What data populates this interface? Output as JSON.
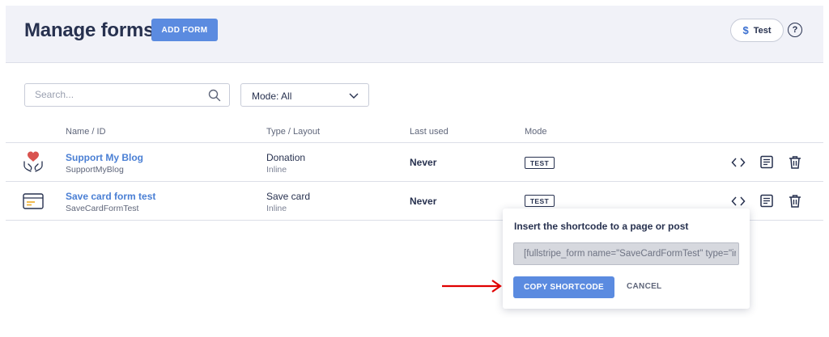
{
  "header": {
    "title": "Manage forms",
    "add_form_label": "ADD FORM",
    "mode_symbol": "$",
    "mode_label": "Test",
    "help_symbol": "?"
  },
  "filters": {
    "search_placeholder": "Search...",
    "mode_select_value": "Mode: All"
  },
  "table": {
    "columns": [
      "Name / ID",
      "Type / Layout",
      "Last used",
      "Mode"
    ],
    "rows": [
      {
        "icon": "heart-hands-icon",
        "name": "Support My Blog",
        "id": "SupportMyBlog",
        "type": "Donation",
        "layout": "Inline",
        "last_used": "Never",
        "mode": "TEST"
      },
      {
        "icon": "card-icon",
        "name": "Save card form test",
        "id": "SaveCardFormTest",
        "type": "Save card",
        "layout": "Inline",
        "last_used": "Never",
        "mode": "TEST"
      }
    ],
    "row_actions": [
      "code-icon",
      "document-icon",
      "trash-icon"
    ]
  },
  "popover": {
    "title": "Insert the shortcode to a page or post",
    "shortcode_value": "[fullstripe_form name=\"SaveCardFormTest\" type=\"inline_save_card\"]",
    "copy_label": "COPY SHORTCODE",
    "cancel_label": "CANCEL"
  },
  "colors": {
    "accent": "#5b8be0",
    "link": "#4a7fd4",
    "text": "#27314f",
    "header_bg": "#f1f2f8",
    "heart": "#d9534f",
    "annotation_arrow": "#e00000"
  }
}
